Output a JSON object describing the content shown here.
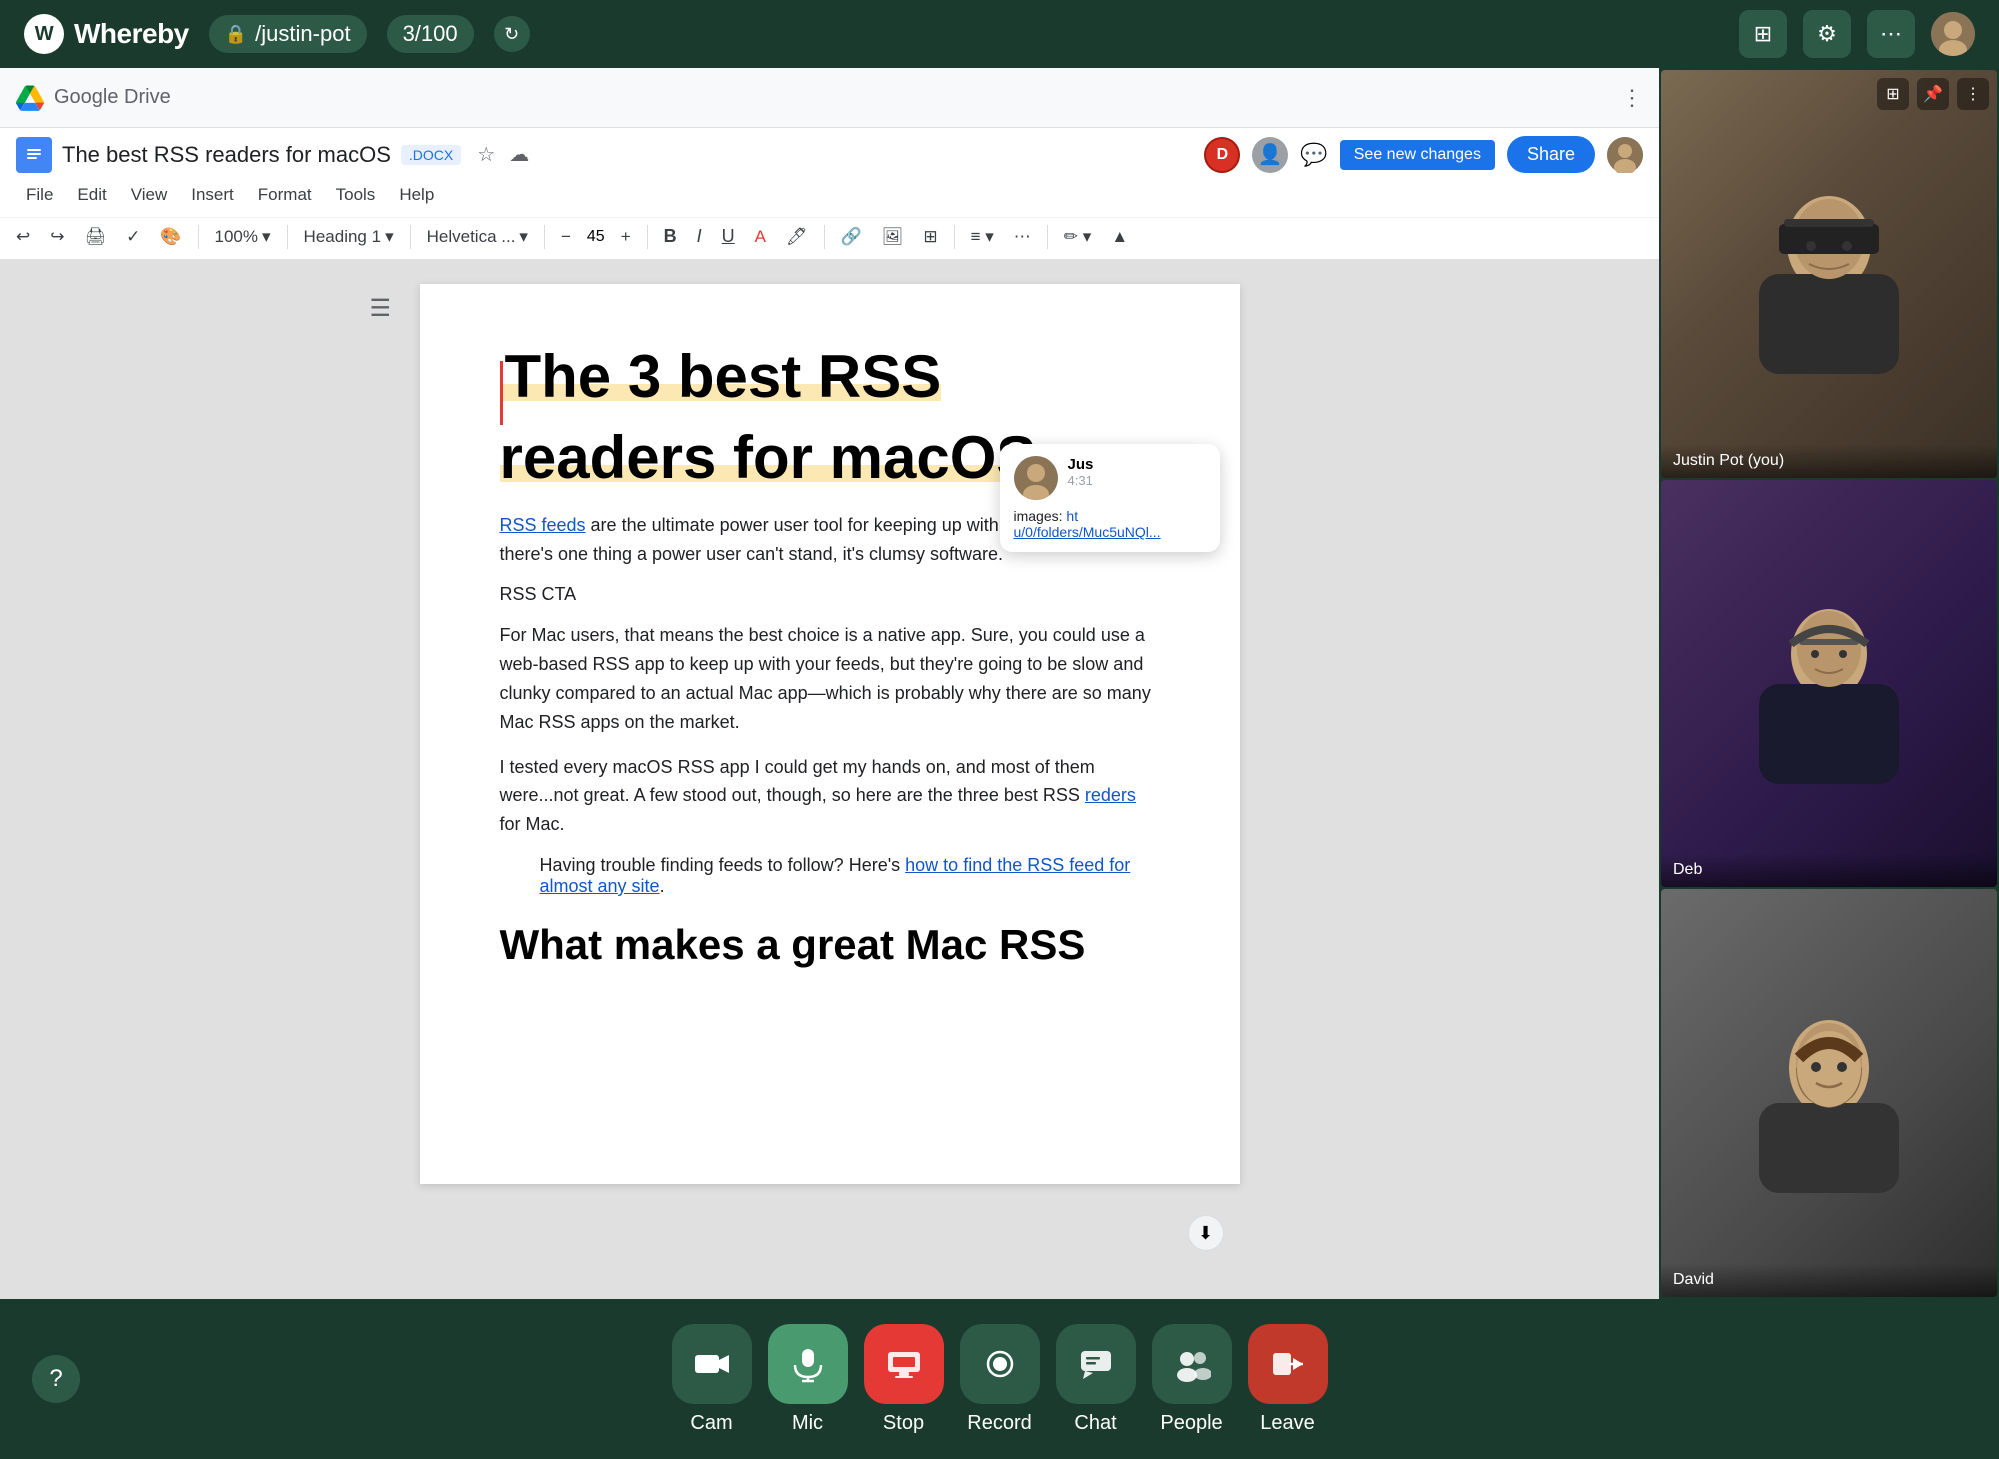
{
  "app": {
    "name": "Whereby"
  },
  "topbar": {
    "url": "/justin-pot",
    "counter": "3/100",
    "icons": {
      "grid": "⊞",
      "settings": "⚙",
      "more": "⋯"
    }
  },
  "gdrive": {
    "title": "Google Drive",
    "dots": "⋮"
  },
  "doc": {
    "title": "The best RSS readers for macOS",
    "badge": ".DOCX",
    "see_new_changes": "See new changes",
    "share": "Share",
    "menus": [
      "File",
      "Edit",
      "View",
      "Insert",
      "Format",
      "Tools",
      "Help"
    ],
    "heading_style": "Heading 1",
    "font": "Helvetica ...",
    "font_size": "45",
    "heading": "The 3 best RSS readers for macOS",
    "rss_cta": "RSS CTA",
    "para1": "RSS feeds are the ultimate power user tool for keeping up with the news. And if there's one thing a power user can't stand, it's clumsy software.",
    "rss_feeds_link": "RSS feeds",
    "para2": "For Mac users, that means the best choice is a native app. Sure, you could use a web-based RSS app to keep up with your feeds, but they're going to be slow and clunky compared to an actual Mac app—which is probably why there are so many Mac RSS apps on the market.",
    "para3": "I tested every macOS RSS app I could get my hands on, and most of them were...not great. A few stood out, though, so here are the three best RSS reders for Mac.",
    "reders_link": "reders",
    "blockquote": "Having trouble finding feeds to follow? Here's how to find the RSS feed for almost any site.",
    "blockquote_link": "how to find the RSS feed for almost any site",
    "h2": "What makes a great Mac RSS"
  },
  "chat_bubble": {
    "name": "Jus",
    "time": "4:31",
    "text": "images: ht",
    "link": "u/0/folders/Muc5uNQl..."
  },
  "video_panel": {
    "tiles": [
      {
        "name": "Justin Pot (you)",
        "bg": "justin"
      },
      {
        "name": "Deb",
        "bg": "deb"
      },
      {
        "name": "David",
        "bg": "david"
      }
    ]
  },
  "bottombar": {
    "help": "?",
    "buttons": [
      {
        "label": "Cam",
        "icon": "📷",
        "style": "dark"
      },
      {
        "label": "Mic",
        "icon": "🎤",
        "style": "active"
      },
      {
        "label": "Stop",
        "icon": "🖥",
        "style": "screen"
      },
      {
        "label": "Record",
        "icon": "⏺",
        "style": "dark"
      },
      {
        "label": "Chat",
        "icon": "💬",
        "style": "dark"
      },
      {
        "label": "People",
        "icon": "👥",
        "style": "dark"
      },
      {
        "label": "Leave",
        "icon": "🚪",
        "style": "red"
      }
    ]
  }
}
